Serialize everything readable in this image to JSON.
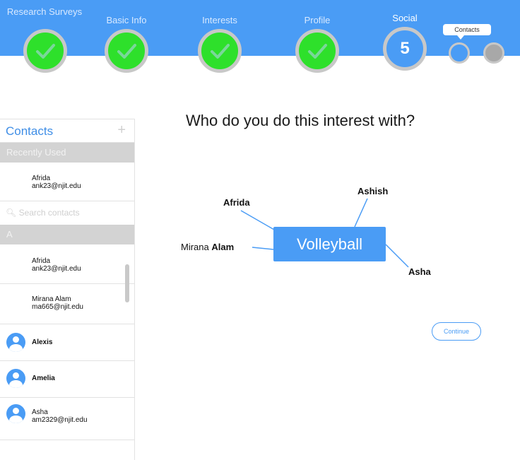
{
  "progress": {
    "steps": [
      {
        "label": "Research Surveys",
        "state": "complete"
      },
      {
        "label": "Basic Info",
        "state": "complete"
      },
      {
        "label": "Interests",
        "state": "complete"
      },
      {
        "label": "Profile",
        "state": "complete"
      },
      {
        "label": "Social",
        "state": "current",
        "number": "5"
      }
    ],
    "tooltip": "Contacts"
  },
  "sidebar": {
    "title": "Contacts",
    "add_symbol": "+",
    "recent_header": "Recently Used",
    "recent": [
      {
        "name": "Afrida",
        "email": "ank23@njit.edu"
      }
    ],
    "search_placeholder": "Search contacts",
    "letter_header": "A",
    "contacts": [
      {
        "name": "Afrida",
        "email": "ank23@njit.edu",
        "avatar": false
      },
      {
        "name": "Mirana Alam",
        "email": "ma665@njit.edu",
        "avatar": false
      },
      {
        "name": "Alexis",
        "email": "",
        "avatar": true
      },
      {
        "name": "Amelia",
        "email": "",
        "avatar": true
      },
      {
        "name": "Asha",
        "email": "am2329@njit.edu",
        "avatar": true
      }
    ]
  },
  "main": {
    "question": "Who do you do this interest with?",
    "interest": "Volleyball",
    "connections": {
      "afrida": "Afrida",
      "ashish": "Ashish",
      "mirana_first": "Mirana",
      "mirana_last": "Alam",
      "asha": "Asha"
    },
    "continue_label": "Continue"
  },
  "colors": {
    "accent": "#4a9cf5",
    "complete": "#2ee02b",
    "ring": "#c8c8c8",
    "section_bg": "#d3d3d3"
  }
}
